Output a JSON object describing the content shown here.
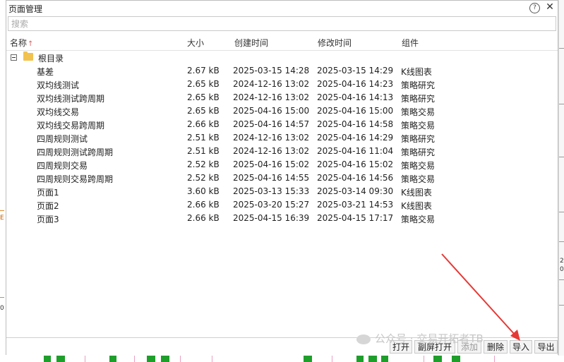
{
  "window": {
    "title": "页面管理"
  },
  "search": {
    "placeholder": "搜索",
    "value": ""
  },
  "columns": {
    "name": "名称",
    "sort_indicator": "↑",
    "size": "大小",
    "created": "创建时间",
    "modified": "修改时间",
    "component": "组件"
  },
  "tree": {
    "root": {
      "label": "根目录",
      "expanded": true
    },
    "items": [
      {
        "name": "基差",
        "size": "2.67 kB",
        "created": "2025-03-15 14:28",
        "modified": "2025-03-15 14:29",
        "component": "K线图表"
      },
      {
        "name": "双均线测试",
        "size": "2.65 kB",
        "created": "2024-12-16 13:02",
        "modified": "2025-04-16 14:23",
        "component": "策略研究"
      },
      {
        "name": "双均线测试跨周期",
        "size": "2.65 kB",
        "created": "2024-12-16 13:02",
        "modified": "2025-04-16 14:13",
        "component": "策略研究"
      },
      {
        "name": "双均线交易",
        "size": "2.65 kB",
        "created": "2025-04-16 15:00",
        "modified": "2025-04-16 15:00",
        "component": "策略交易"
      },
      {
        "name": "双均线交易跨周期",
        "size": "2.66 kB",
        "created": "2025-04-16 14:57",
        "modified": "2025-04-16 14:58",
        "component": "策略交易"
      },
      {
        "name": "四周规则测试",
        "size": "2.51 kB",
        "created": "2024-12-16 13:02",
        "modified": "2025-04-16 14:29",
        "component": "策略研究"
      },
      {
        "name": "四周规则测试跨周期",
        "size": "2.51 kB",
        "created": "2024-12-16 13:02",
        "modified": "2025-04-16 11:04",
        "component": "策略研究"
      },
      {
        "name": "四周规则交易",
        "size": "2.52 kB",
        "created": "2025-04-16 15:02",
        "modified": "2025-04-16 15:02",
        "component": "策略交易"
      },
      {
        "name": "四周规则交易跨周期",
        "size": "2.52 kB",
        "created": "2025-04-16 14:55",
        "modified": "2025-04-16 14:56",
        "component": "策略交易"
      },
      {
        "name": "页面1",
        "size": "3.60 kB",
        "created": "2025-03-13 15:33",
        "modified": "2025-03-14 09:30",
        "component": "K线图表"
      },
      {
        "name": "页面2",
        "size": "2.66 kB",
        "created": "2025-03-20 15:27",
        "modified": "2025-03-21 14:53",
        "component": "K线图表"
      },
      {
        "name": "页面3",
        "size": "2.66 kB",
        "created": "2025-04-15 16:39",
        "modified": "2025-04-15 17:17",
        "component": "策略交易"
      }
    ]
  },
  "footer": {
    "open": "打开",
    "fullscreen_open": "副屏打开",
    "add": "添加",
    "delete": "删除",
    "import": "导入",
    "export": "导出"
  },
  "watermark": {
    "text": "公众号 · 交易开拓者TB"
  },
  "background_labels": {
    "left_tick": "E",
    "left_tick2": "0",
    "right_tick1": "2",
    "right_tick2": "0"
  },
  "colors": {
    "folder": "#f1c24f",
    "sort_arrow": "#e05a5a",
    "annotation_arrow": "#e53935",
    "candle_green": "#1e9e2a"
  },
  "icons": {
    "help": "help-icon",
    "close": "close-icon",
    "folder": "folder-icon",
    "expander": "collapse-icon"
  }
}
